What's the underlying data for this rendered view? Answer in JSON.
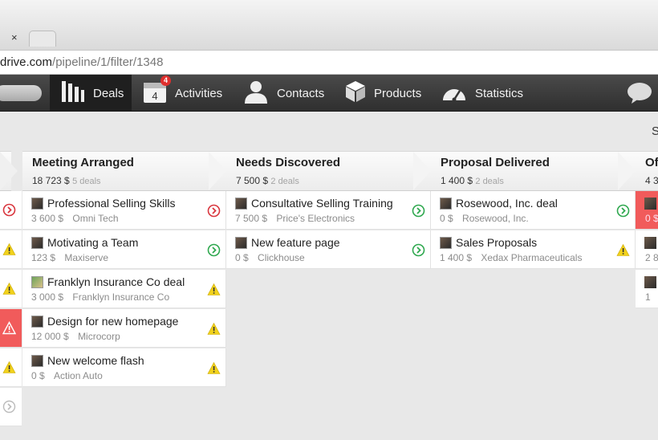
{
  "browser": {
    "url_host": "drive.com",
    "url_path": "/pipeline/1/filter/1348",
    "tab_close": "×"
  },
  "nav": {
    "items": [
      {
        "label": "Deals",
        "icon": "deals-bars-icon"
      },
      {
        "label": "Activities",
        "icon": "calendar-icon",
        "calendar_day": "4",
        "badge": "4"
      },
      {
        "label": "Contacts",
        "icon": "person-icon"
      },
      {
        "label": "Products",
        "icon": "box-icon"
      },
      {
        "label": "Statistics",
        "icon": "gauge-icon"
      }
    ],
    "chat_icon": "chat-bubble-icon"
  },
  "toolbar": {
    "cut_label": "S"
  },
  "stages": [
    {
      "name": "Meeting Arranged",
      "amount": "18 723 $",
      "count": "5 deals"
    },
    {
      "name": "Needs Discovered",
      "amount": "7 500 $",
      "count": "2 deals"
    },
    {
      "name": "Proposal Delivered",
      "amount": "1 400 $",
      "count": "2 deals"
    },
    {
      "name": "Of",
      "amount": "4 3",
      "count": ""
    }
  ],
  "columns": [
    [
      {
        "title": "Professional Selling Skills",
        "value": "3 600 $",
        "org": "Omni Tech",
        "status": "overdue",
        "avatar": "person"
      },
      {
        "title": "Motivating a Team",
        "value": "123 $",
        "org": "Maxiserve",
        "status": "planned",
        "avatar": "person"
      },
      {
        "title": "Franklyn Insurance Co deal",
        "value": "3 000 $",
        "org": "Franklyn Insurance Co",
        "status": "warning",
        "avatar": "photo"
      },
      {
        "title": "Design for new homepage",
        "value": "12 000 $",
        "org": "Microcorp",
        "status": "warning",
        "avatar": "person"
      },
      {
        "title": "New welcome flash",
        "value": "0 $",
        "org": "Action Auto",
        "status": "warning",
        "avatar": "person"
      }
    ],
    [
      {
        "title": "Consultative Selling Training",
        "value": "7 500 $",
        "org": "Price's Electronics",
        "status": "planned",
        "avatar": "person"
      },
      {
        "title": "New feature page",
        "value": "0 $",
        "org": "Clickhouse",
        "status": "planned",
        "avatar": "person"
      }
    ],
    [
      {
        "title": "Rosewood, Inc. deal",
        "value": "0 $",
        "org": "Rosewood, Inc.",
        "status": "planned",
        "avatar": "person"
      },
      {
        "title": "Sales Proposals",
        "value": "1 400 $",
        "org": "Xedax Pharmaceuticals",
        "status": "warning",
        "avatar": "person"
      }
    ]
  ],
  "left_partial": [
    "overdue",
    "warning",
    "warning",
    "alert-red",
    "warning",
    "none"
  ],
  "right_partial": [
    {
      "meta": "0 $",
      "red": true
    },
    {
      "meta": "2 8",
      "red": false
    },
    {
      "meta": "1 ",
      "red": false
    }
  ],
  "colors": {
    "overdue": "#d9363e",
    "planned": "#2fa84f",
    "warning": "#f2d21b",
    "alert_red": "#f15b5b"
  }
}
